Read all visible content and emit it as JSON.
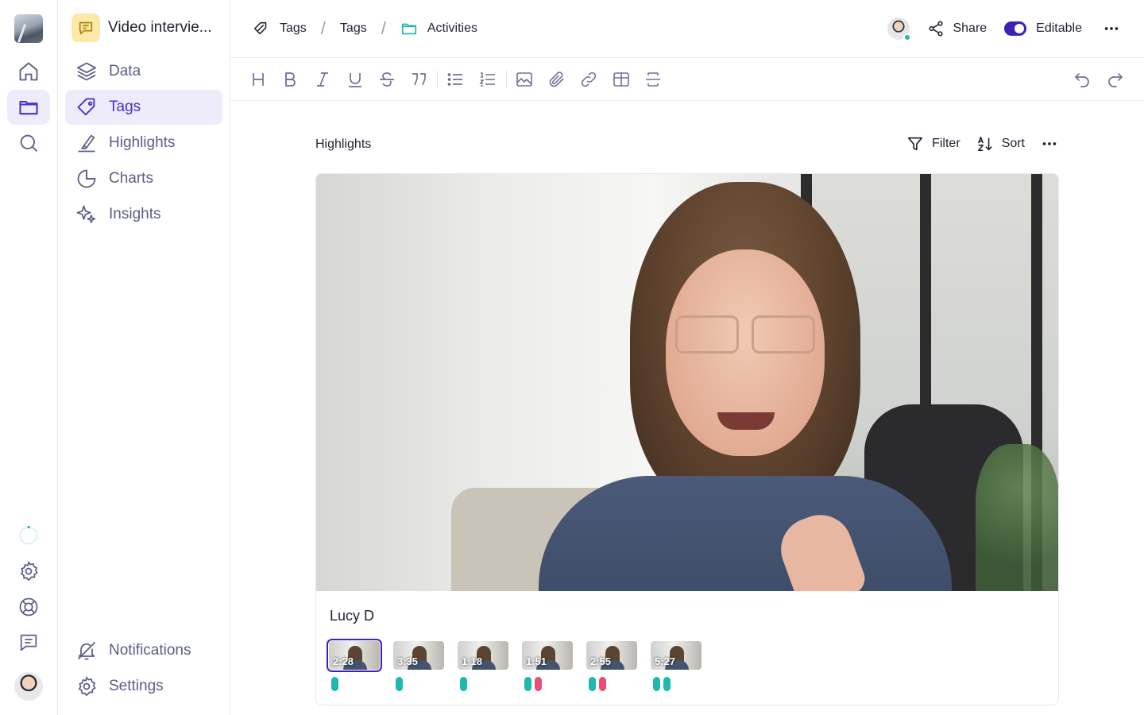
{
  "sidebar": {
    "project_name": "Video intervie...",
    "items": [
      {
        "label": "Data",
        "icon": "layers-icon"
      },
      {
        "label": "Tags",
        "icon": "tag-icon",
        "active": true
      },
      {
        "label": "Highlights",
        "icon": "highlighter-icon"
      },
      {
        "label": "Charts",
        "icon": "pie-chart-icon"
      },
      {
        "label": "Insights",
        "icon": "sparkles-icon"
      }
    ],
    "bottom": [
      {
        "label": "Notifications",
        "icon": "bell-off-icon"
      },
      {
        "label": "Settings",
        "icon": "gear-icon"
      }
    ]
  },
  "rail": {
    "icons": [
      "home-icon",
      "folder-icon",
      "search-icon",
      "loading-spinner-icon",
      "gear-icon",
      "lifebuoy-icon",
      "chat-icon"
    ]
  },
  "breadcrumb": {
    "items": [
      "Tags",
      "Tags",
      "Activities"
    ],
    "separator": "/"
  },
  "header": {
    "share_label": "Share",
    "editable_label": "Editable",
    "editable_on": true
  },
  "toolbar": {
    "tools": [
      "heading-icon",
      "bold-icon",
      "italic-icon",
      "underline-icon",
      "strikethrough-icon",
      "quote-icon",
      "bullet-list-icon",
      "numbered-list-icon",
      "image-icon",
      "attachment-icon",
      "link-icon",
      "table-icon",
      "divider-icon",
      "undo-icon",
      "redo-icon"
    ]
  },
  "content": {
    "section_title": "Highlights",
    "filter_label": "Filter",
    "sort_label": "Sort"
  },
  "card": {
    "person_name": "Lucy D",
    "clips": [
      {
        "time": "2:28",
        "selected": true,
        "tags": [
          "#1fb8b1"
        ]
      },
      {
        "time": "3:35",
        "selected": false,
        "tags": [
          "#1fb8b1"
        ]
      },
      {
        "time": "1:18",
        "selected": false,
        "tags": [
          "#1fb8b1"
        ]
      },
      {
        "time": "1:51",
        "selected": false,
        "tags": [
          "#1fb8b1",
          "#ef4b7a"
        ]
      },
      {
        "time": "2:55",
        "selected": false,
        "tags": [
          "#1fb8b1",
          "#ef4b7a"
        ]
      },
      {
        "time": "5:27",
        "selected": false,
        "tags": [
          "#1fb8b1",
          "#1fb8b1"
        ]
      }
    ]
  },
  "colors": {
    "accent": "#4a2fc8",
    "accent_bg": "#eeebfb",
    "teal": "#1fb8b1",
    "pink": "#ef4b7a"
  }
}
